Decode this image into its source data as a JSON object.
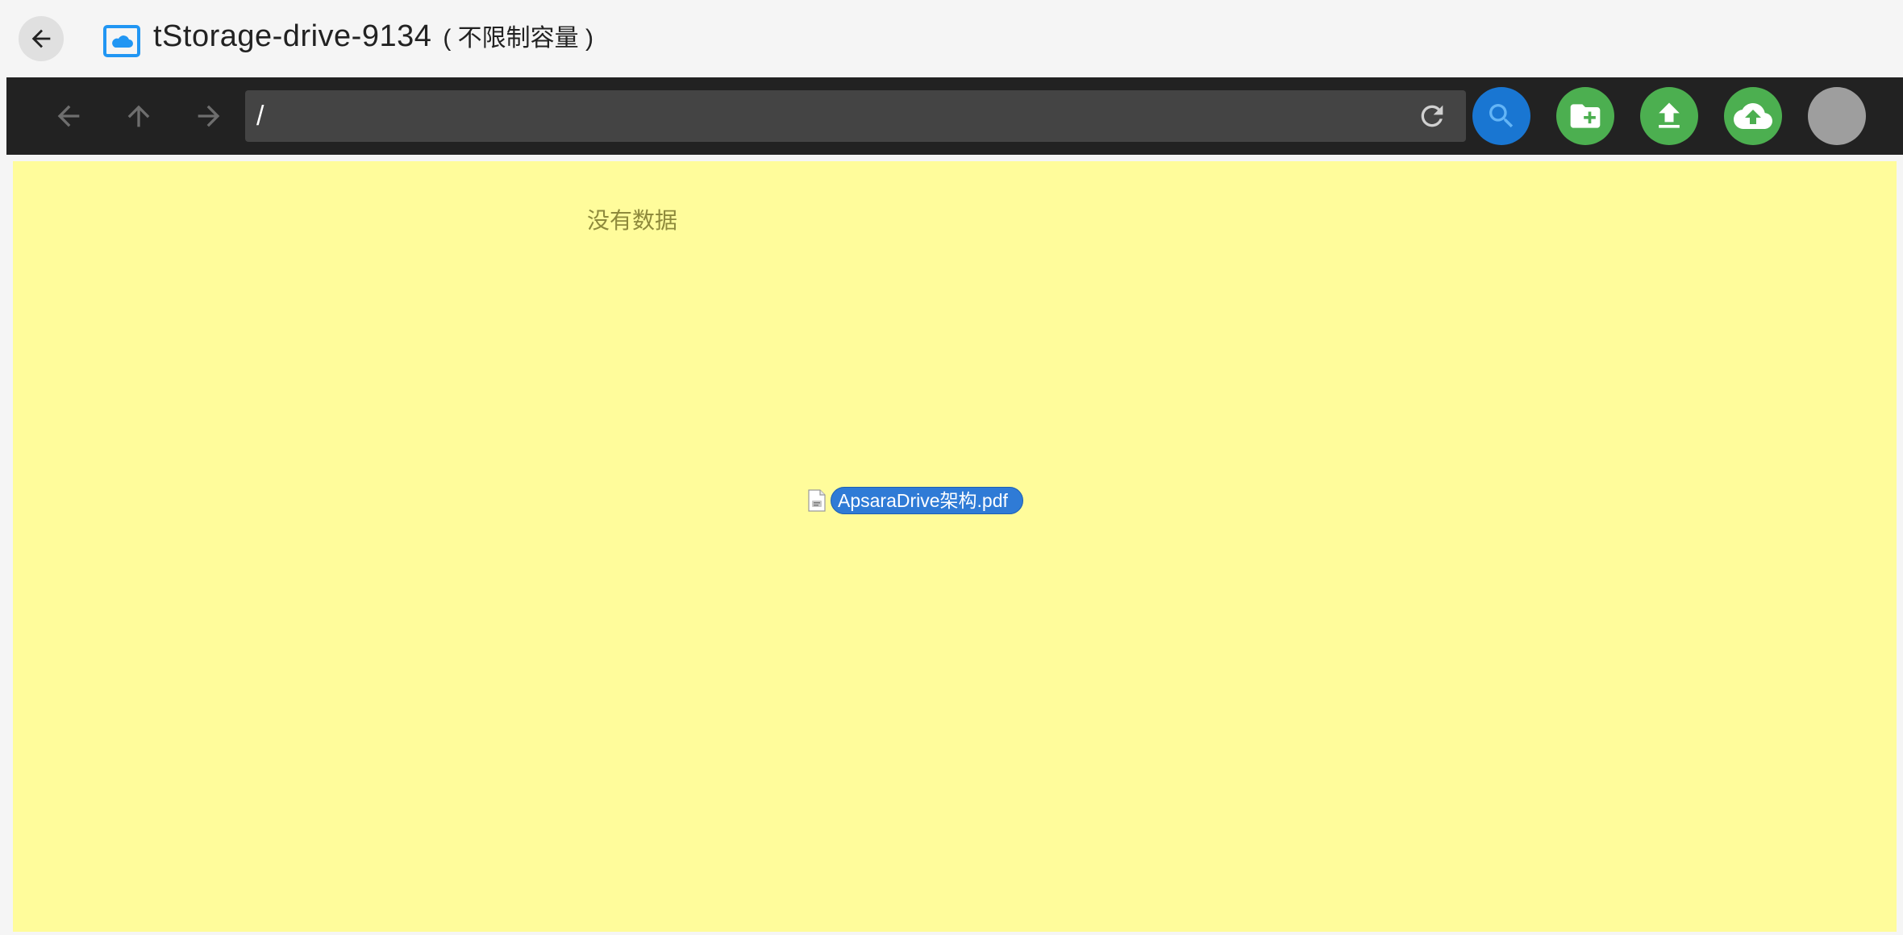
{
  "header": {
    "back_icon": "arrow-left-icon",
    "drive_icon": "cloud-drive-icon",
    "title": "tStorage-drive-9134",
    "capacity": "( 不限制容量 )"
  },
  "toolbar": {
    "nav": {
      "back_icon": "arrow-left-icon",
      "up_icon": "arrow-up-icon",
      "forward_icon": "arrow-right-icon"
    },
    "path": {
      "value": "/"
    },
    "refresh_icon": "refresh-icon",
    "buttons": [
      {
        "name": "search",
        "icon": "search-icon",
        "color": "#1976d2"
      },
      {
        "name": "new-folder",
        "icon": "folder-plus-icon",
        "color": "#4caf50"
      },
      {
        "name": "upload",
        "icon": "upload-icon",
        "color": "#4caf50"
      },
      {
        "name": "cloud-upload",
        "icon": "cloud-upload-icon",
        "color": "#4caf50"
      },
      {
        "name": "user",
        "icon": "avatar",
        "color": "#9e9e9e"
      }
    ]
  },
  "main": {
    "background": "#fffc9b",
    "empty_message": "没有数据",
    "dragged_file": {
      "icon": "pdf-file-icon",
      "name": "ApsaraDrive架构.pdf"
    }
  }
}
